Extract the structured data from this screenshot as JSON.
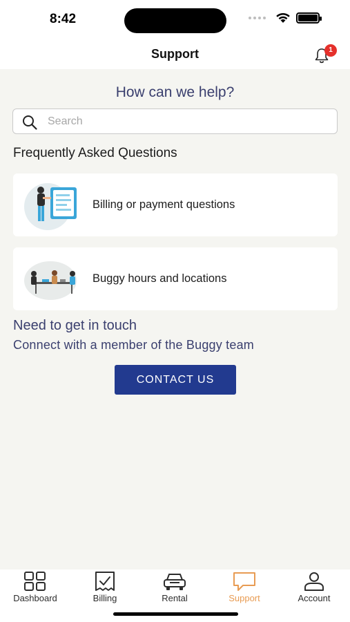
{
  "status_bar": {
    "time": "8:42"
  },
  "header": {
    "title": "Support",
    "notification_count": "1"
  },
  "help": {
    "heading": "How can we help?"
  },
  "search": {
    "placeholder": "Search",
    "value": ""
  },
  "faq": {
    "title": "Frequently Asked Questions",
    "items": [
      {
        "label": "Billing or payment questions",
        "icon": "billing-illustration"
      },
      {
        "label": "Buggy hours and locations",
        "icon": "meeting-illustration"
      }
    ]
  },
  "contact": {
    "title": "Need to get in touch",
    "subtitle": "Connect with a member of the Buggy team",
    "button_label": "CONTACT US"
  },
  "tabs": [
    {
      "label": "Dashboard",
      "icon": "grid-icon"
    },
    {
      "label": "Billing",
      "icon": "receipt-icon"
    },
    {
      "label": "Rental",
      "icon": "car-icon"
    },
    {
      "label": "Support",
      "icon": "chat-icon",
      "active": true
    },
    {
      "label": "Account",
      "icon": "person-icon"
    }
  ],
  "colors": {
    "accent": "#223a8f",
    "heading": "#3a3f6e",
    "active_tab": "#e89b52",
    "badge": "#e5302b",
    "background": "#f5f5f1"
  }
}
